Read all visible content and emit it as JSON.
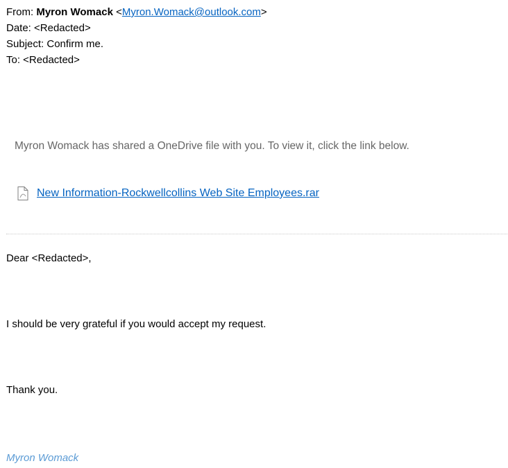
{
  "header": {
    "from_label": "From: ",
    "sender_name": "Myron Womack",
    "email_open": " <",
    "sender_email": "Myron.Womack@outlook.com",
    "email_close": ">",
    "date": "Date: <Redacted>",
    "subject": "Subject: Confirm me.",
    "to": "To: <Redacted>"
  },
  "share": {
    "message": "Myron Womack has shared a OneDrive file with you. To view it, click the link below.",
    "file_icon": "document-icon",
    "file_name": "New Information-Rockwellcollins Web Site Employees.rar"
  },
  "body": {
    "greeting": "Dear <Redacted>,",
    "request": "I should be very grateful if you would accept my request.",
    "thanks": "Thank you.",
    "signature": "Myron Womack"
  },
  "colors": {
    "link": "#0563c1",
    "share_text": "#666666",
    "signature": "#5b9bd5"
  }
}
